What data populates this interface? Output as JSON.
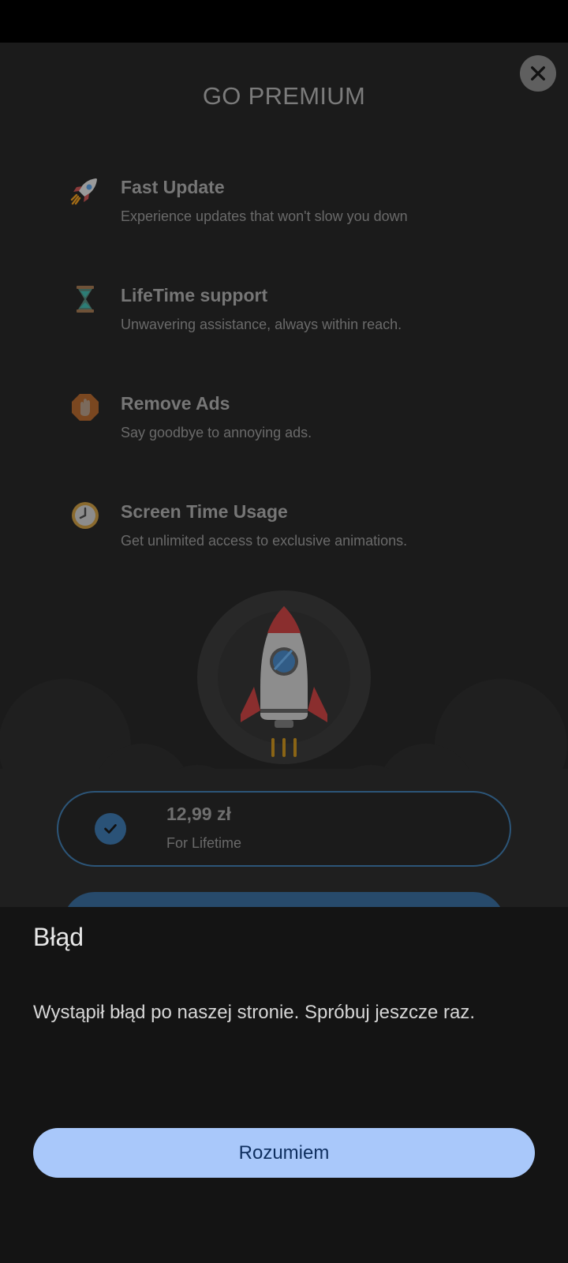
{
  "header": {
    "title": "GO PREMIUM"
  },
  "features": [
    {
      "icon": "rocket-icon",
      "title": "Fast Update",
      "desc": "Experience updates that won't slow you down"
    },
    {
      "icon": "hourglass-icon",
      "title": "LifeTime support",
      "desc": "Unwavering assistance, always within reach."
    },
    {
      "icon": "stop-hand-icon",
      "title": "Remove Ads",
      "desc": "Say goodbye to annoying ads."
    },
    {
      "icon": "clock-icon",
      "title": "Screen Time Usage",
      "desc": "Get unlimited access to exclusive animations."
    }
  ],
  "plan": {
    "price": "12,99 zł",
    "period": "For Lifetime",
    "selected": true
  },
  "dialog": {
    "title": "Błąd",
    "message": "Wystąpił błąd po naszej stronie. Spróbuj jeszcze raz.",
    "ok_label": "Rozumiem"
  },
  "colors": {
    "accent": "#a9c8fa",
    "plan_border": "#2c5578",
    "dialog_bg": "#141414"
  }
}
